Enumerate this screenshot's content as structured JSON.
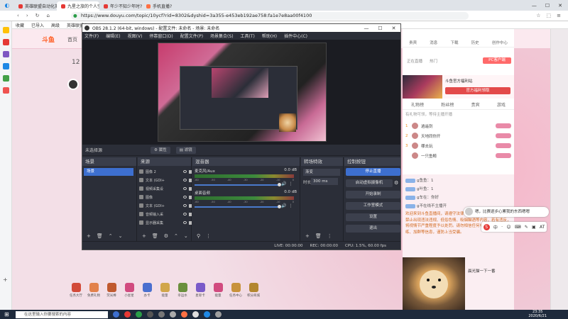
{
  "browser": {
    "tabs": [
      {
        "label": "英雄联盟自动化英雄网…",
        "color": "#e53935"
      },
      {
        "label": "九星之旅的个人空间 - AcFun弹幕…",
        "color": "#e53935"
      },
      {
        "label": "年少不知少年时?",
        "color": "#e53935"
      },
      {
        "label": "手机直播?",
        "color": "#ff7043"
      }
    ],
    "url": "https://www.douyu.com/topic/10ycf?rid=8302&dyshid=3a355-e453eb192ae758:fa1e7e8aa00f4100",
    "bookmarks": [
      "收藏",
      "已导入",
      "高级",
      "英雄联盟自动化"
    ],
    "window_controls": [
      "—",
      "☐",
      "✕"
    ]
  },
  "douyu": {
    "logo": "斗鱼",
    "home": "首页",
    "date_num": "12",
    "rank_tabs": [
      "贵宾",
      "消息",
      "下载",
      "历史",
      "创作中心"
    ],
    "rank_items": [
      "正在直播",
      "热门"
    ],
    "pc_button": "PC客户端",
    "ad_title": "斗鱼官方福利站",
    "ad_button": "官方福利领取",
    "subtabs": [
      "礼物榜",
      "粉丝榜",
      "贵宾",
      "游戏"
    ],
    "notice": "有礼物可领，等待主播开播",
    "rank_list": [
      {
        "no": "1",
        "name": "逍遥剑"
      },
      {
        "no": "2",
        "name": "天地同你开"
      },
      {
        "no": "3",
        "name": "哪去玩"
      },
      {
        "no": "",
        "name": "一只鱼鲸"
      }
    ],
    "chat_lines": [
      "ɡ鱼鱼：1",
      "ɡ叶鱼：1",
      "ɡ车在：你好",
      "ɡ不在线不主播开"
    ],
    "system_text": "欢迎来到斗鱼直播间，请遵守法律法规，文明发言。直播间内禁止出现违法违规、低俗色情、吸烟酗酒等内容，若有违反，将视情节严重程度予以处罚。请勿相信任何非官方的中奖、代练、加群等信息，谨防上当受骗。",
    "chat_user": "晨光猫一下一番",
    "gifts": [
      "任务大厅",
      "免费礼物",
      "荧光棒",
      "小星星",
      "办卡",
      "能量",
      "幸运水",
      "星际卡",
      "能量",
      "任务中心",
      "积分商城"
    ],
    "gift_colors": [
      "#d24b3a",
      "#e2814b",
      "#c05a2f",
      "#d14b7f",
      "#4a6fcf",
      "#d1a64a",
      "#6a8f3d",
      "#7a5bc9",
      "#d14b7f",
      "#c8923b",
      "#b3862f"
    ]
  },
  "ime": {
    "tip": "嗯，比赛逐步心累我的东西嗯嗯",
    "bar": [
      "中",
      "·",
      "☺",
      "⌨",
      "✎",
      "▣",
      "AT"
    ]
  },
  "taskbar": {
    "search_placeholder": "在这里输入你要搜索的内容",
    "icons": [
      "#3d6fcf",
      "#e53935",
      "#2a9d48",
      "#555",
      "#777",
      "#aaa",
      "#ff7043",
      "#ddd",
      "#1e88e5",
      "#9e9e9e"
    ],
    "time": "23:35",
    "date": "2020/6/21"
  },
  "obs": {
    "title": "OBS 28.1.2 (64-bit, windows) - 配置文件: 未命名 - 场景: 未命名",
    "menu": [
      "文件(F)",
      "编辑(E)",
      "视图(V)",
      "停靠窗口(D)",
      "配置文件(P)",
      "场景集合(S)",
      "工具(T)",
      "帮助(H)",
      "插件中心(C)"
    ],
    "no_source": "未选择源",
    "props_btn": "属性",
    "filters_btn": "滤镜",
    "docks": {
      "scenes": "场景",
      "sources": "来源",
      "mixer": "混音器",
      "transitions": "转场特效",
      "controls": "控制按钮"
    },
    "scene_items": [
      "场景"
    ],
    "sources": [
      "图像 2",
      "文本 (GDI+",
      "视频采集设",
      "图像",
      "文本 (GDI+",
      "音频输入采",
      "显示器采集"
    ],
    "mixer": [
      {
        "name": "麦克风/Aux",
        "db": "0.0 dB"
      },
      {
        "name": "桌面音频",
        "db": "0.0 dB"
      }
    ],
    "meter_ticks": [
      "-60",
      "-55",
      "-50",
      "-45",
      "-40",
      "-35",
      "-30",
      "-25",
      "-20",
      "-15",
      "-10",
      "-5",
      "0"
    ],
    "transition": "渐变",
    "duration_label": "时长",
    "duration": "300 ms",
    "controls": [
      "停止直播",
      "启动虚拟摄像机",
      "开始录制",
      "工作室模式",
      "设置",
      "退出"
    ],
    "status": {
      "live": "LIVE: 00:00:00",
      "rec": "REC: 00:00:00",
      "cpu": "CPU: 1.5%, 60.00 fps"
    }
  }
}
